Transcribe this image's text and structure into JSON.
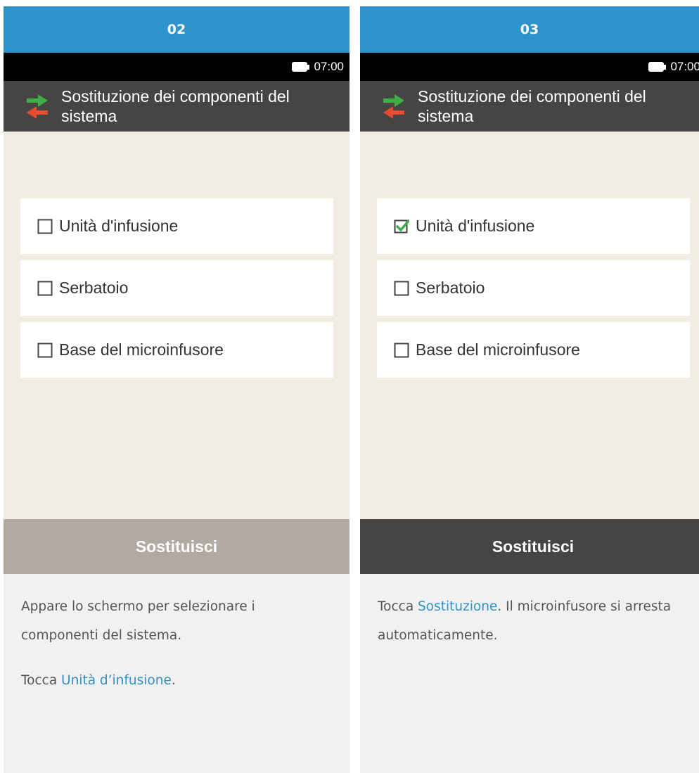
{
  "colors": {
    "header_blue": "#2e93cc",
    "title_bar": "#474444",
    "screen_background": "#f1ede4",
    "button_disabled": "#b0aaa3",
    "button_enabled": "#474444",
    "link": "#2e93cc",
    "check_green": "#3fae49",
    "arrow_green": "#3fae49",
    "arrow_red": "#e84a2f"
  },
  "panels": [
    {
      "step": "02",
      "time": "07:00",
      "battery_icon": "battery-full-icon",
      "title_icon": "swap-arrows-icon",
      "title": "Sostituzione dei componenti del sistema",
      "items": [
        {
          "label": "Unità d'infusione",
          "checked": false
        },
        {
          "label": "Serbatoio",
          "checked": false
        },
        {
          "label": "Base del microinfusore",
          "checked": false
        }
      ],
      "button_label": "Sostituisci",
      "button_enabled": false,
      "desc_line1": "Appare lo schermo per selezionare i componenti del sistema.",
      "desc_line2_prefix": "Tocca ",
      "desc_line2_link": "Unità d’infusione",
      "desc_line2_suffix": "."
    },
    {
      "step": "03",
      "time": "07:00",
      "battery_icon": "battery-full-icon",
      "title_icon": "swap-arrows-icon",
      "title": "Sostituzione dei componenti del sistema",
      "items": [
        {
          "label": "Unità d'infusione",
          "checked": true
        },
        {
          "label": "Serbatoio",
          "checked": false
        },
        {
          "label": "Base del microinfusore",
          "checked": false
        }
      ],
      "button_label": "Sostituisci",
      "button_enabled": true,
      "desc_prefix": "Tocca ",
      "desc_link": "Sostituzione",
      "desc_suffix": ". Il microinfusore si arresta automaticamente."
    }
  ]
}
